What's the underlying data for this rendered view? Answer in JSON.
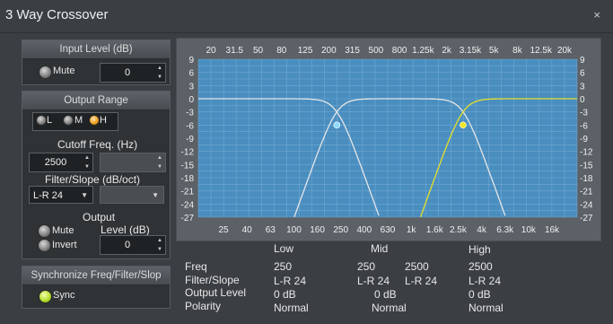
{
  "window": {
    "title": "3 Way Crossover",
    "close_glyph": "×"
  },
  "input_level": {
    "header": "Input Level (dB)",
    "mute_label": "Mute",
    "mute_on": false,
    "value": "0"
  },
  "output_range": {
    "header": "Output Range",
    "bands": [
      {
        "label": "L",
        "selected": false
      },
      {
        "label": "M",
        "selected": false
      },
      {
        "label": "H",
        "selected": true
      }
    ],
    "cutoff_label": "Cutoff Freq. (Hz)",
    "cutoff_value": "2500",
    "filter_label": "Filter/Slope (dB/oct)",
    "filter_value": "L-R 24",
    "output_label": "Output",
    "level_label": "Level (dB)",
    "level_value": "0",
    "mute_label": "Mute",
    "invert_label": "Invert"
  },
  "sync": {
    "header": "Synchronize Freq/Filter/Slop",
    "label": "Sync",
    "on": true
  },
  "graph": {
    "freq_top_labels": [
      "20",
      "31.5",
      "50",
      "80",
      "125",
      "200",
      "315",
      "500",
      "800",
      "1.25k",
      "2k",
      "3.15k",
      "5k",
      "8k",
      "12.5k",
      "20k"
    ],
    "freq_bottom_labels": [
      "25",
      "40",
      "63",
      "100",
      "160",
      "250",
      "400",
      "630",
      "1k",
      "1.6k",
      "2.5k",
      "4k",
      "6.3k",
      "10k",
      "16k"
    ],
    "db_labels": [
      "9",
      "6",
      "3",
      "0",
      "-3",
      "-6",
      "-9",
      "-12",
      "-15",
      "-18",
      "-21",
      "-24",
      "-27"
    ],
    "crossover_low_hz": 250,
    "crossover_high_hz": 2500,
    "crossover_level_db": -6,
    "colors": {
      "plot_bg": "#4a8ec0",
      "grid": "#7fb3d9",
      "curve_white": "#e6e6e6",
      "curve_high": "#e8e02a",
      "marker_low": "#8fd8ff",
      "marker_high": "#f2e62a"
    }
  },
  "summary": {
    "col_headers": [
      "Low",
      "Mid",
      "High"
    ],
    "row_labels": [
      "Freq",
      "Filter/Slope",
      "Output Level",
      "Polarity"
    ],
    "low": {
      "freq": "250",
      "filter": "L-R 24",
      "level": "0 dB",
      "polarity": "Normal"
    },
    "mid": {
      "freq_low": "250",
      "freq_high": "2500",
      "filter_low": "L-R 24",
      "filter_high": "L-R 24",
      "level": "0 dB",
      "polarity": "Normal"
    },
    "high": {
      "freq": "2500",
      "filter": "L-R 24",
      "level": "0 dB",
      "polarity": "Normal"
    }
  }
}
